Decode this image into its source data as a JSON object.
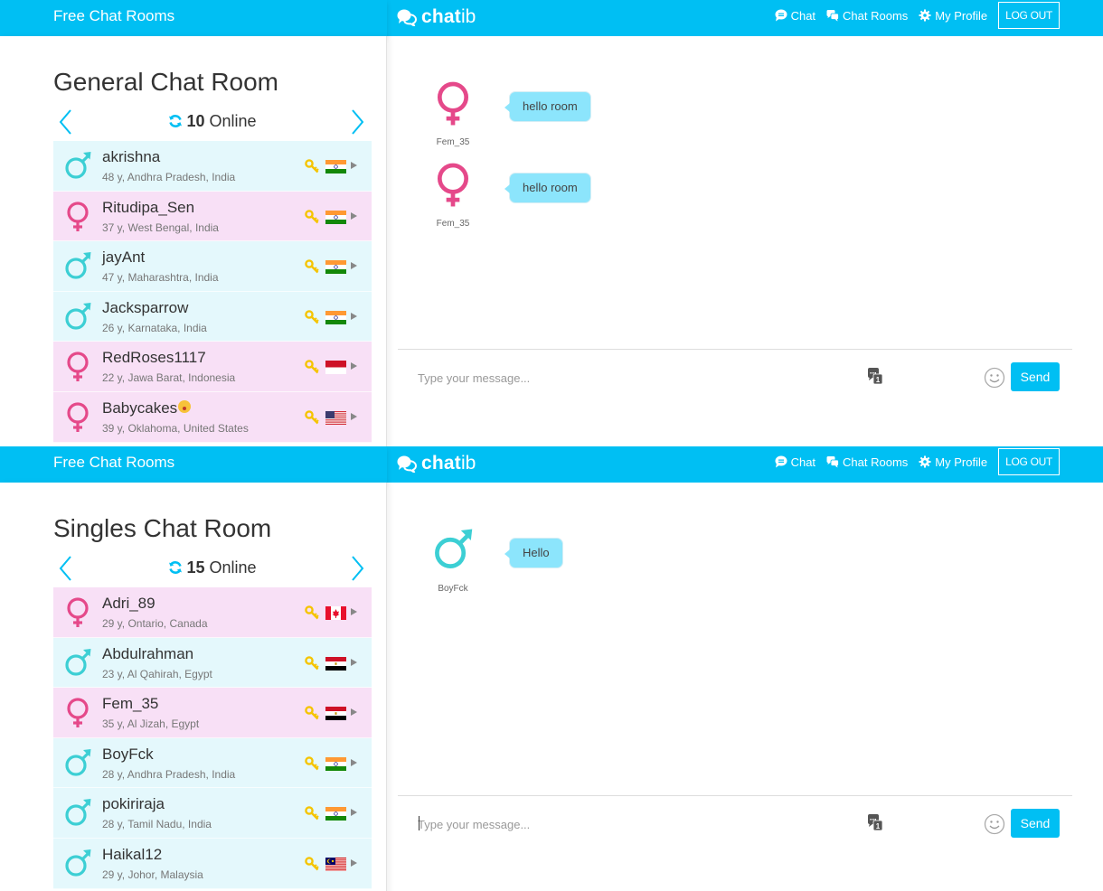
{
  "colors": {
    "brand": "#00bff3",
    "male": "#3ccfd4",
    "female": "#e5498a",
    "male_row_bg": "#e4f8fc",
    "female_row_bg": "#f8e0f6",
    "bubble": "#8ce5fc",
    "key": "#f5c400"
  },
  "screens": [
    {
      "header": {
        "left_title": "Free Chat Rooms",
        "brand_bold": "chat",
        "brand_light": "ib",
        "nav": [
          {
            "icon": "chat-bubble-icon",
            "label": "Chat"
          },
          {
            "icon": "chat-rooms-icon",
            "label": "Chat Rooms"
          },
          {
            "icon": "gear-icon",
            "label": "My Profile"
          }
        ],
        "logout_label": "LOG OUT"
      },
      "room": {
        "title": "General Chat Room",
        "online_count": "10",
        "online_label": "Online"
      },
      "users": [
        {
          "name": "akrishna",
          "emoji": false,
          "info": "48 y, Andhra Pradesh, India",
          "gender": "male",
          "flag": "india"
        },
        {
          "name": "Ritudipa_Sen",
          "emoji": false,
          "info": "37 y, West Bengal, India",
          "gender": "female",
          "flag": "india"
        },
        {
          "name": "jayAnt",
          "emoji": false,
          "info": "47 y, Maharashtra, India",
          "gender": "male",
          "flag": "india"
        },
        {
          "name": "Jacksparrow",
          "emoji": false,
          "info": "26 y, Karnataka, India",
          "gender": "male",
          "flag": "india"
        },
        {
          "name": "RedRoses1117",
          "emoji": false,
          "info": "22 y, Jawa Barat, Indonesia",
          "gender": "female",
          "flag": "indonesia"
        },
        {
          "name": "Babycakes",
          "emoji": true,
          "info": "39 y, Oklahoma, United States",
          "gender": "female",
          "flag": "usa"
        }
      ],
      "messages": [
        {
          "sender": "Fem_35",
          "gender": "female",
          "text": "hello room"
        },
        {
          "sender": "Fem_35",
          "gender": "female",
          "text": "hello room"
        }
      ],
      "composer": {
        "placeholder": "Type your message...",
        "value": "",
        "send_label": "Send",
        "focused": false
      }
    },
    {
      "header": {
        "left_title": "Free Chat Rooms",
        "brand_bold": "chat",
        "brand_light": "ib",
        "nav": [
          {
            "icon": "chat-bubble-icon",
            "label": "Chat"
          },
          {
            "icon": "chat-rooms-icon",
            "label": "Chat Rooms"
          },
          {
            "icon": "gear-icon",
            "label": "My Profile"
          }
        ],
        "logout_label": "LOG OUT"
      },
      "room": {
        "title": "Singles Chat Room",
        "online_count": "15",
        "online_label": "Online"
      },
      "users": [
        {
          "name": "Adri_89",
          "emoji": false,
          "info": "29 y, Ontario, Canada",
          "gender": "female",
          "flag": "canada"
        },
        {
          "name": "Abdulrahman",
          "emoji": false,
          "info": "23 y, Al Qahirah, Egypt",
          "gender": "male",
          "flag": "egypt"
        },
        {
          "name": "Fem_35",
          "emoji": false,
          "info": "35 y, Al Jizah, Egypt",
          "gender": "female",
          "flag": "egypt"
        },
        {
          "name": "BoyFck",
          "emoji": false,
          "info": "28 y, Andhra Pradesh, India",
          "gender": "male",
          "flag": "india"
        },
        {
          "name": "pokiriraja",
          "emoji": false,
          "info": "28 y, Tamil Nadu, India",
          "gender": "male",
          "flag": "india"
        },
        {
          "name": "Haikal12",
          "emoji": false,
          "info": "29 y, Johor, Malaysia",
          "gender": "male",
          "flag": "malaysia"
        }
      ],
      "messages": [
        {
          "sender": "BoyFck",
          "gender": "male",
          "text": "Hello"
        }
      ],
      "composer": {
        "placeholder": "Type your message...",
        "value": "",
        "send_label": "Send",
        "focused": true
      }
    }
  ]
}
